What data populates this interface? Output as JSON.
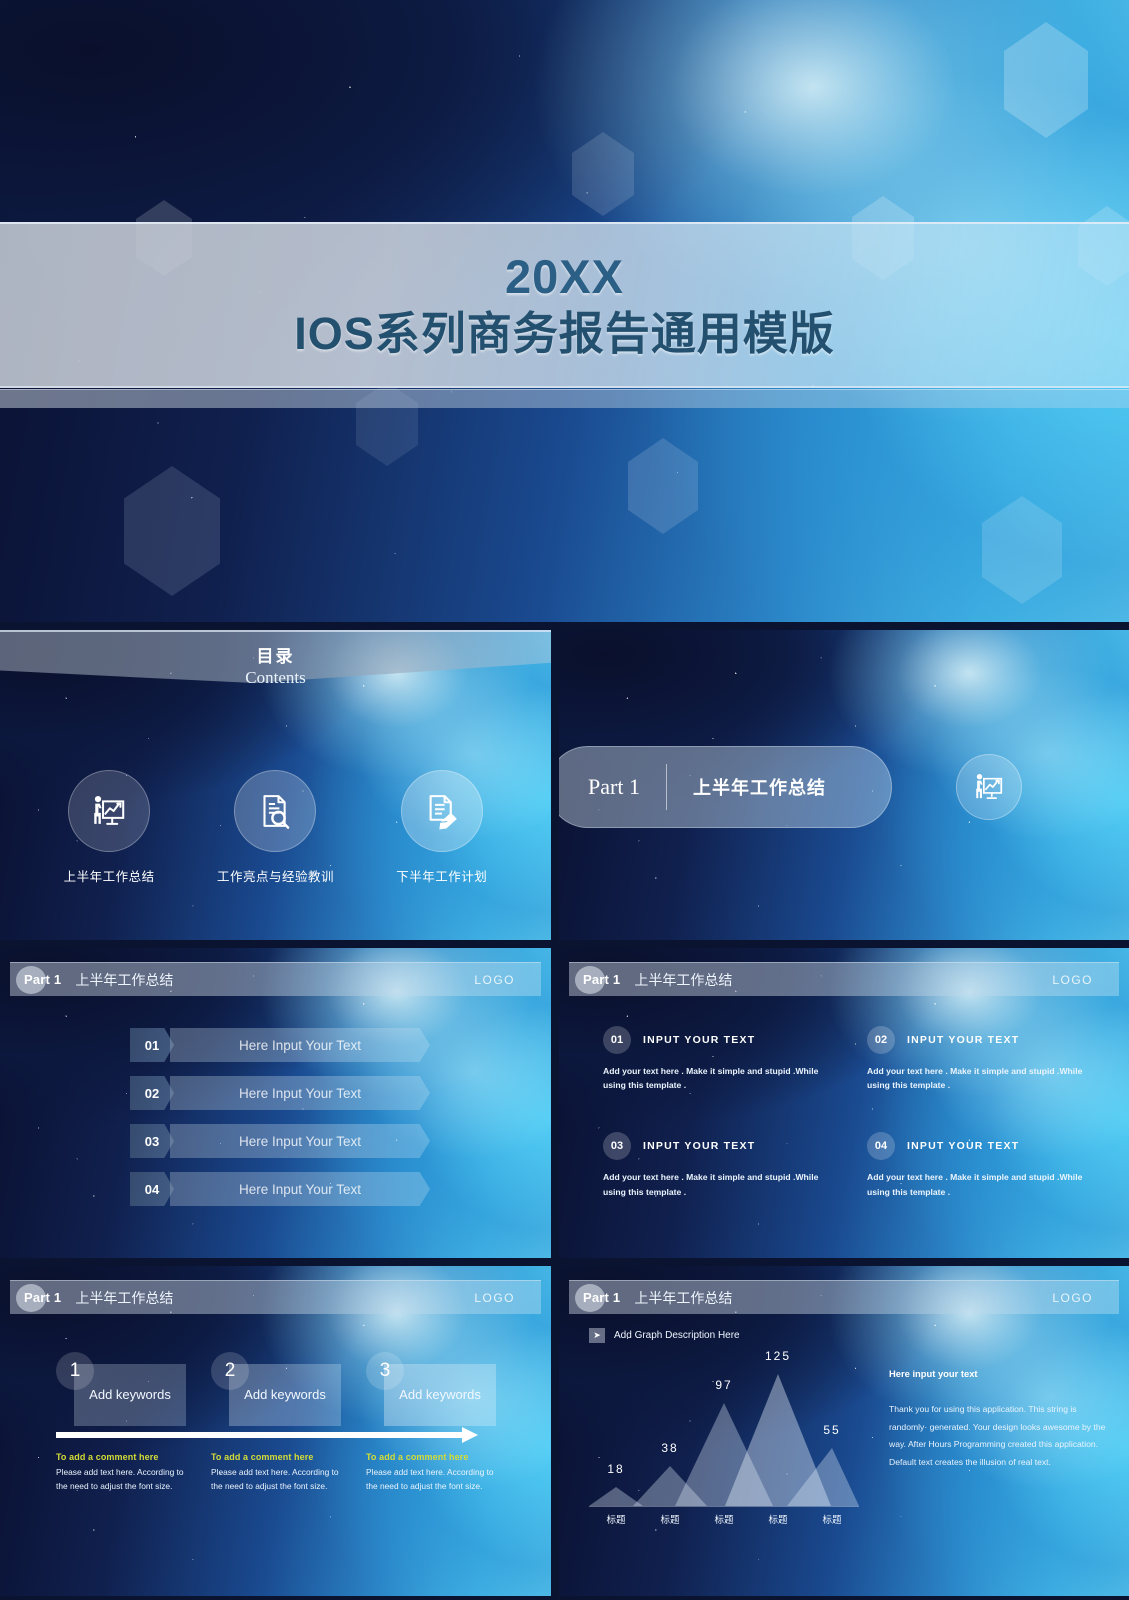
{
  "title_slide": {
    "year": "20XX",
    "main_title": "IOS系列商务报告通用模版"
  },
  "contents_slide": {
    "heading_cn": "目录",
    "heading_en": "Contents",
    "items": [
      {
        "label": "上半年工作总结",
        "icon": "presentation-chart-icon"
      },
      {
        "label": "工作亮点与经验教训",
        "icon": "document-search-icon"
      },
      {
        "label": "下半年工作计划",
        "icon": "document-pencil-icon"
      }
    ]
  },
  "section_slide": {
    "part": "Part 1",
    "title": "上半年工作总结",
    "icon": "presentation-chart-icon"
  },
  "header": {
    "part": "Part 1",
    "subtitle": "上半年工作总结",
    "logo": "LOGO"
  },
  "list_slide": {
    "rows": [
      {
        "num": "01",
        "text": "Here Input Your Text"
      },
      {
        "num": "02",
        "text": "Here Input Your Text"
      },
      {
        "num": "03",
        "text": "Here Input Your Text"
      },
      {
        "num": "04",
        "text": "Here Input Your Text"
      }
    ]
  },
  "grid_slide": {
    "cells": [
      {
        "num": "01",
        "title": "INPUT  YOUR  TEXT",
        "body": "Add your text here . Make it simple and stupid .While using this template ."
      },
      {
        "num": "02",
        "title": "INPUT  YOUR  TEXT",
        "body": "Add your text here . Make it simple and stupid .While using this template ."
      },
      {
        "num": "03",
        "title": "INPUT  YOUR  TEXT",
        "body": "Add your text here . Make it simple and stupid .While using this template ."
      },
      {
        "num": "04",
        "title": "INPUT  YOUR  TEXT",
        "body": "Add your text here . Make it simple and stupid .While using this template ."
      }
    ]
  },
  "timeline_slide": {
    "steps": [
      {
        "num": "1",
        "keyword": "Add keywords",
        "comment_title": "To add a comment here",
        "comment_body": "Please  add  text  here. According to the need to adjust the font size."
      },
      {
        "num": "2",
        "keyword": "Add keywords",
        "comment_title": "To add a comment here",
        "comment_body": "Please  add  text  here. According to the need to adjust the font size."
      },
      {
        "num": "3",
        "keyword": "Add keywords",
        "comment_title": "To add a comment here",
        "comment_body": "Please  add  text  here. According to the need to adjust the font size."
      }
    ],
    "accent_color": "#d4dd35"
  },
  "chart_slide": {
    "description": "Add Graph Description Here",
    "right_heading": "Here input your text",
    "right_body": "Thank you for using this application. This string is randomly· generated. Your design looks awesome by the way. After Hours Programming created this application. Default text creates the illusion of real text."
  },
  "chart_data": {
    "type": "area",
    "title": "Add Graph Description Here",
    "categories": [
      "标题",
      "标题",
      "标题",
      "标题",
      "标题"
    ],
    "values": [
      18,
      38,
      97,
      125,
      55
    ],
    "xlabel": "",
    "ylabel": "",
    "ylim": [
      0,
      140
    ],
    "grid": false,
    "legend": "none",
    "note": "Five overlapping translucent triangular peaks; data labels shown above each peak."
  }
}
